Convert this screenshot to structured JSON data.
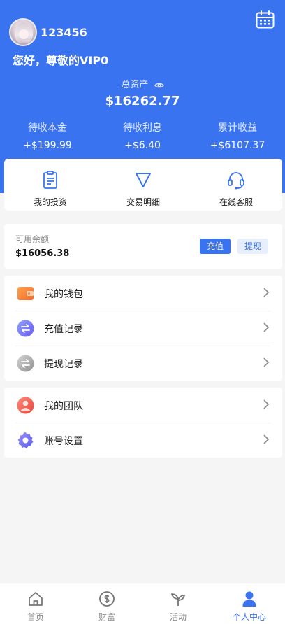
{
  "user": {
    "username": "123456",
    "greeting": "您好，尊敬的VIP0"
  },
  "assets": {
    "total_label": "总资产",
    "total_value": "$16262.77",
    "stats": [
      {
        "label": "待收本金",
        "value": "+$199.99"
      },
      {
        "label": "待收利息",
        "value": "+$6.40"
      },
      {
        "label": "累计收益",
        "value": "+$6107.37"
      }
    ]
  },
  "quick_actions": [
    {
      "label": "我的投资",
      "icon": "clipboard-icon"
    },
    {
      "label": "交易明细",
      "icon": "triangle-down-icon"
    },
    {
      "label": "在线客服",
      "icon": "headset-icon"
    }
  ],
  "balance": {
    "label": "可用余额",
    "value": "$16056.38",
    "recharge_label": "充值",
    "withdraw_label": "提现"
  },
  "menu_group_1": [
    {
      "label": "我的钱包",
      "icon": "wallet-icon"
    },
    {
      "label": "充值记录",
      "icon": "exchange-icon"
    },
    {
      "label": "提现记录",
      "icon": "exchange-gray-icon"
    }
  ],
  "menu_group_2": [
    {
      "label": "我的团队",
      "icon": "team-icon"
    },
    {
      "label": "账号设置",
      "icon": "gear-icon"
    }
  ],
  "tabbar": [
    {
      "label": "首页",
      "icon": "home-icon"
    },
    {
      "label": "财富",
      "icon": "dollar-coin-icon"
    },
    {
      "label": "活动",
      "icon": "sprout-icon"
    },
    {
      "label": "个人中心",
      "icon": "person-icon",
      "active": true
    }
  ],
  "colors": {
    "primary": "#3a73f0",
    "background": "#f5f5f5"
  }
}
